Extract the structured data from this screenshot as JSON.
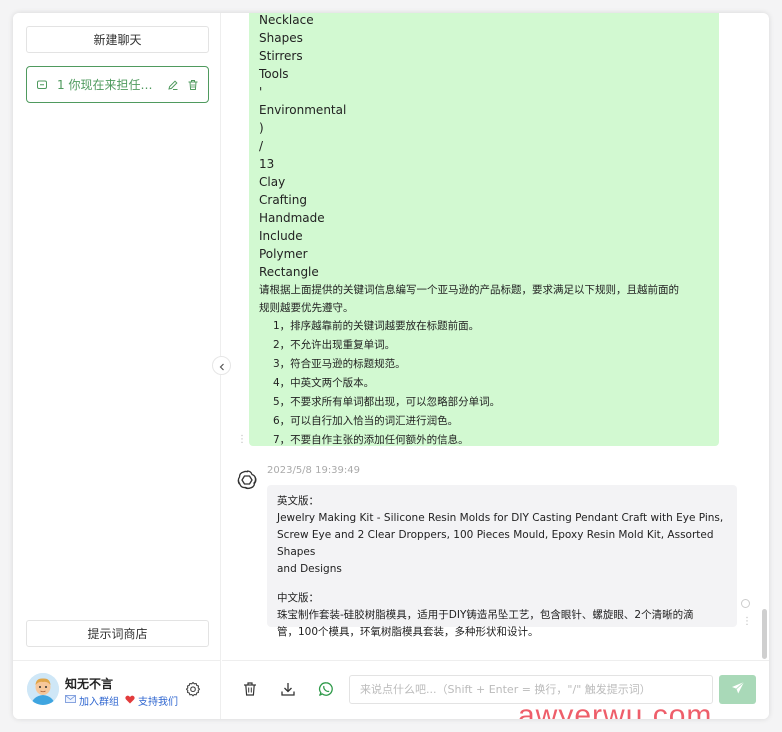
{
  "sidebar": {
    "new_chat_label": "新建聊天",
    "history": [
      {
        "title": "1 你现在来担任一..."
      }
    ],
    "prompt_store_label": "提示词商店",
    "user": {
      "name": "知无不言",
      "join_group": "加入群组",
      "support": "支持我们"
    }
  },
  "messages": {
    "user_words": [
      "Necklace",
      "Shapes",
      "Stirrers",
      "Tools",
      "'",
      "Environmental",
      ")",
      "/",
      "13",
      "Clay",
      "Crafting",
      "Handmade",
      "Include",
      "Polymer",
      "Rectangle"
    ],
    "user_instruction": [
      "请根据上面提供的关键词信息编写一个亚马逊的产品标题，要求满足以下规则，且越前面的",
      "规则越要优先遵守。"
    ],
    "user_rules": [
      "1，排序越靠前的关键词越要放在标题前面。",
      "2，不允许出现重复单词。",
      "3，符合亚马逊的标题规范。",
      "4，中英文两个版本。",
      "5，不要求所有单词都出现，可以忽略部分单词。",
      "6，可以自行加入恰当的词汇进行润色。",
      "7，不要自作主张的添加任何额外的信息。"
    ],
    "bot_timestamp": "2023/5/8 19:39:49",
    "bot_en_heading": "英文版：",
    "bot_en_lines": [
      "Jewelry Making Kit - Silicone Resin Molds for DIY Casting Pendant Craft with Eye Pins,",
      "Screw Eye and 2 Clear Droppers, 100 Pieces Mould, Epoxy Resin Mold Kit, Assorted Shapes",
      "and Designs"
    ],
    "bot_zh_heading": "中文版：",
    "bot_zh_lines": [
      "珠宝制作套装-硅胶树脂模具，适用于DIY铸造吊坠工艺，包含眼针、螺旋眼、2个清晰的滴",
      "管，100个模具，环氧树脂模具套装，多种形状和设计。"
    ]
  },
  "footer": {
    "input_placeholder": "来说点什么吧...（Shift + Enter = 换行，\"/\" 触发提示词）"
  },
  "watermark": "awyerwu.com",
  "colors": {
    "accent": "#4f9a5e",
    "user_bubble": "#d2f9d1",
    "bot_bubble": "#f3f3f5",
    "send_button": "#a9d9b8",
    "watermark": "#e82838"
  },
  "icons": {
    "history_item": "chat-bubble-icon",
    "edit": "pencil-icon",
    "delete": "trash-icon",
    "settings": "gear-icon",
    "collapse": "chevron-left-icon",
    "bot": "openai-logo-icon",
    "footer_delete": "trash-icon",
    "download": "download-icon",
    "whatsapp": "whatsapp-icon",
    "send": "paper-plane-icon"
  }
}
